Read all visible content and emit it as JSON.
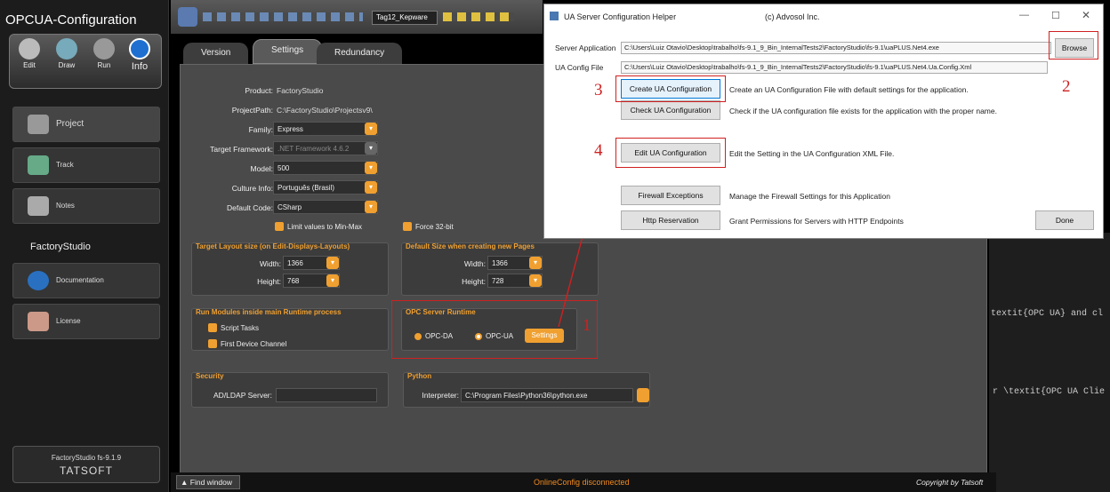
{
  "app": {
    "title": "OPCUA-Configuration"
  },
  "ribbon": [
    {
      "label": "Edit"
    },
    {
      "label": "Draw"
    },
    {
      "label": "Run"
    },
    {
      "label": "Info"
    }
  ],
  "nav": {
    "items": [
      {
        "label": "Project"
      },
      {
        "label": "Track"
      },
      {
        "label": "Notes"
      }
    ],
    "section": "FactoryStudio",
    "items2": [
      {
        "label": "Documentation"
      },
      {
        "label": "License"
      }
    ]
  },
  "footer": {
    "version": "FactoryStudio fs-9.1.9",
    "brand": "TATSOFT",
    "find": "Find window",
    "status": "OnlineConfig disconnected",
    "copyright": "Copyright by Tatsoft"
  },
  "toolbar": {
    "tag": "Tag12_Kepware"
  },
  "tabs": [
    {
      "label": "Version"
    },
    {
      "label": "Settings"
    },
    {
      "label": "Redundancy"
    }
  ],
  "settings": {
    "product": {
      "label": "Product:",
      "value": "FactoryStudio"
    },
    "path": {
      "label": "ProjectPath:",
      "value": "C:\\FactoryStudio\\Projectsv9\\"
    },
    "family": {
      "label": "Family:",
      "value": "Express"
    },
    "framework": {
      "label": "Target Framework:",
      "value": ".NET Framework 4.6.2"
    },
    "model": {
      "label": "Model:",
      "value": "500"
    },
    "culture": {
      "label": "Culture Info:",
      "value": "Português (Brasil)"
    },
    "code": {
      "label": "Default Code:",
      "value": "CSharp"
    },
    "limit": "Limit values to Min-Max",
    "force32": "Force 32-bit",
    "layout": {
      "title": "Target Layout size (on Edit-Displays-Layouts)",
      "width_label": "Width:",
      "width": "1366",
      "height_label": "Height:",
      "height": "768"
    },
    "pages": {
      "title": "Default Size when creating new Pages",
      "width_label": "Width:",
      "width": "1366",
      "height_label": "Height:",
      "height": "728"
    },
    "modules": {
      "title": "Run Modules inside main Runtime process",
      "script": "Script Tasks",
      "device": "First Device Channel"
    },
    "opc": {
      "title": "OPC Server Runtime",
      "da": "OPC-DA",
      "ua": "OPC-UA",
      "settings": "Settings"
    },
    "security": {
      "title": "Security",
      "label": "AD/LDAP Server:"
    },
    "python": {
      "title": "Python",
      "label": "Interpreter:",
      "value": "C:\\Program Files\\Python36\\python.exe"
    }
  },
  "dialog": {
    "title": "UA Server Configuration Helper",
    "company": "(c) Advosol Inc.",
    "server_label": "Server Application",
    "server_path": "C:\\Users\\Luiz Otavio\\Desktop\\trabalho\\fs-9.1_9_Bin_InternalTests2\\FactoryStudio\\fs-9.1\\uaPLUS.Net4.exe",
    "config_label": "UA Config File",
    "config_path": "C:\\Users\\Luiz Otavio\\Desktop\\trabalho\\fs-9.1_9_Bin_InternalTests2\\FactoryStudio\\fs-9.1\\uaPLUS.Net4.Ua.Config.Xml",
    "browse": "Browse",
    "rows": [
      {
        "btn": "Create UA Configuration",
        "desc": "Create an UA Configuration File with default settings for the application."
      },
      {
        "btn": "Check UA Configuration",
        "desc": "Check if the UA configuration file exists for the application with the proper name."
      },
      {
        "btn": "Edit UA Configuration",
        "desc": "Edit the Setting in the UA Configuration XML File."
      },
      {
        "btn": "Firewall Exceptions",
        "desc": "Manage the Firewall Settings for this Application"
      },
      {
        "btn": "Http Reservation",
        "desc": "Grant Permissions for Servers with HTTP Endpoints"
      }
    ],
    "done": "Done"
  },
  "annotations": [
    "1",
    "2",
    "3",
    "4"
  ],
  "code": {
    "line1": "textit{OPC UA} and cl",
    "line2": "r \\textit{OPC UA Clie"
  }
}
